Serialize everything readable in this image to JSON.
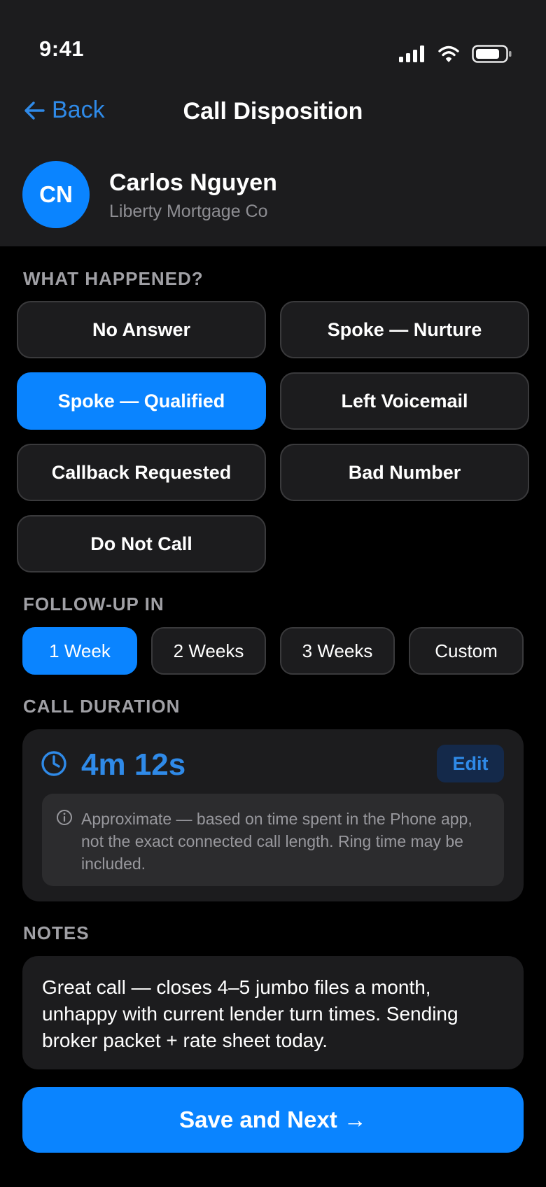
{
  "status_bar": {
    "time": "9:41",
    "icons": [
      "cellular-signal-icon",
      "wifi-icon",
      "battery-icon"
    ]
  },
  "nav": {
    "back_label": "Back",
    "title": "Call Disposition"
  },
  "contact": {
    "initials": "CN",
    "name": "Carlos Nguyen",
    "company": "Liberty Mortgage Co"
  },
  "outcome": {
    "label": "WHAT HAPPENED?",
    "options": [
      {
        "label": "No Answer",
        "selected": false
      },
      {
        "label": "Spoke — Nurture",
        "selected": false
      },
      {
        "label": "Spoke — Qualified",
        "selected": true
      },
      {
        "label": "Left Voicemail",
        "selected": false
      },
      {
        "label": "Callback Requested",
        "selected": false
      },
      {
        "label": "Bad Number",
        "selected": false
      },
      {
        "label": "Do Not Call",
        "selected": false
      }
    ]
  },
  "follow_up": {
    "label": "FOLLOW-UP IN",
    "options": [
      {
        "label": "1 Week",
        "selected": true
      },
      {
        "label": "2 Weeks",
        "selected": false
      },
      {
        "label": "3 Weeks",
        "selected": false
      },
      {
        "label": "Custom",
        "selected": false
      }
    ]
  },
  "duration": {
    "label": "CALL DURATION",
    "value": "4m 12s",
    "edit_label": "Edit",
    "disclaimer": "Approximate — based on time spent in the Phone app, not the exact connected call length. Ring time may be included."
  },
  "notes": {
    "label": "NOTES",
    "text": "Great call — closes 4–5 jumbo files a month, unhappy with current lender turn times. Sending broker packet + rate sheet today."
  },
  "save_label": "Save and Next →",
  "colors": {
    "accent": "#0a84ff",
    "background": "#000000",
    "surface": "#1c1c1e"
  }
}
